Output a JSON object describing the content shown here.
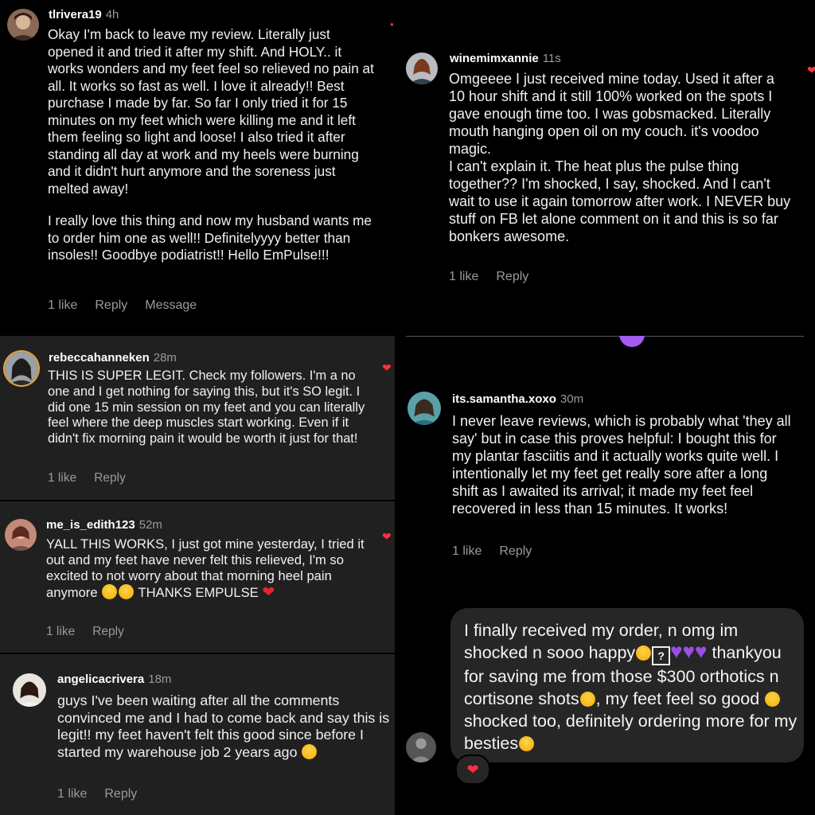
{
  "actions": {
    "like": "1 like",
    "reply": "Reply",
    "message": "Message"
  },
  "comments": [
    {
      "username": "tlrivera19",
      "time": "4h",
      "paragraphs": [
        "Okay I'm back to leave my review. Literally just opened it and tried it after my shift. And HOLY.. it works wonders and my feet feel so relieved no pain at all. It works so fast as well. I love it already!! Best purchase I made by far. So far I only tried it for 15 minutes on my feet which were killing me and it left them feeling so light and loose!  I also tried it after standing all day at work and my heels were burning and it didn't hurt anymore and the soreness just melted away!",
        "I really love this thing and now my husband wants me to order him one as well!! Definitelyyyy better than insoles!! Goodbye podiatrist!! Hello EmPulse!!!"
      ]
    },
    {
      "username": "winemimxannie",
      "time": "11s",
      "paragraphs": [
        "Omgeeee I just received mine today. Used it after a 10 hour shift and it still 100% worked on the spots I gave enough time too. I was gobsmacked. Literally mouth hanging open oil on my couch. it's voodoo magic.",
        "I can't explain it. The heat plus the pulse thing together?? I'm shocked, I say, shocked. And I can't wait to use it again tomorrow after work. I NEVER buy stuff on FB let alone comment on it and this is so far bonkers awesome."
      ]
    },
    {
      "username": "rebeccahanneken",
      "time": "28m",
      "paragraphs": [
        "THIS IS SUPER LEGIT. Check my followers. I'm a no one and I get nothing for saying this, but it's SO legit. I did one 15 min session on my feet and you can literally feel where the deep muscles start working. Even if it didn't fix morning pain it would be worth it just for that!"
      ]
    },
    {
      "username": "its.samantha.xoxo",
      "time": "30m",
      "paragraphs": [
        "I never leave reviews, which is probably what 'they all say' but in case this proves helpful: I bought this for my plantar fasciitis and it actually works quite well. I intentionally let my feet get really sore after a long shift as I awaited its arrival; it made my feet feel recovered in less than 15 minutes. It works!"
      ]
    },
    {
      "username": "me_is_edith123",
      "time": "52m",
      "text_a": "YALL THIS WORKS, I just got mine yesterday, I tried it out and my feet have never felt this relieved, I'm so excited to not worry about that morning heel pain anymore",
      "text_b": "THANKS EMPULSE"
    },
    {
      "username": "angelicacrivera",
      "time": "18m",
      "text": "guys I've been waiting after all the comments convinced me and I had to come back and say this is legit!! my feet haven't felt this good since before I started my warehouse job 2 years ago"
    }
  ],
  "message_bubble": {
    "t1": "I finally received my order, n omg im shocked n sooo happy",
    "t2": "thankyou for saving me from those $300 orthotics n cortisone shots",
    "t3": ", my feet feel so good",
    "t4": " shocked too, definitely ordering more for my besties"
  },
  "icons": [
    "heart-icon",
    "reply-icon",
    "crying-emoji",
    "red-heart-emoji",
    "pleading-emoji",
    "purple-heart-emoji",
    "tired-emoji",
    "heart-eyes-emoji",
    "party-face-emoji"
  ],
  "colors": {
    "panel_dark": "#1f1f1f",
    "panel_black": "#000000",
    "like_heart": "#ff3040",
    "muted_text": "#9a9a9a",
    "bubble": "#262626",
    "purple_heart": "#9b4ee6"
  }
}
